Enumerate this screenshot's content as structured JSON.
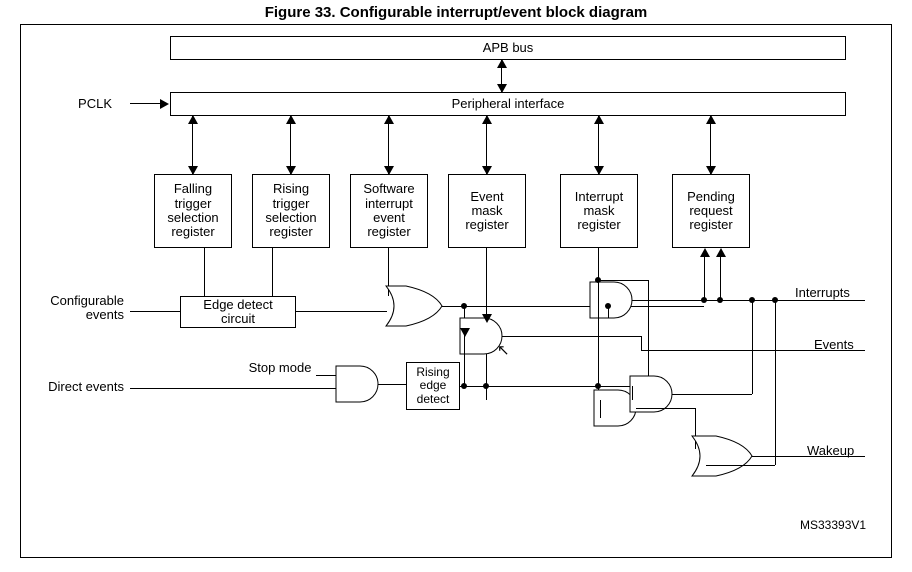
{
  "figure": {
    "caption": "Figure 33. Configurable interrupt/event block diagram",
    "ref": "MS33393V1"
  },
  "blocks": {
    "apb_bus": "APB bus",
    "periph_if": "Peripheral interface",
    "falling_reg_l1": "Falling",
    "falling_reg_l2": "trigger",
    "falling_reg_l3": "selection",
    "falling_reg_l4": "register",
    "rising_reg_l1": "Rising",
    "rising_reg_l2": "trigger",
    "rising_reg_l3": "selection",
    "rising_reg_l4": "register",
    "swi_reg_l1": "Software",
    "swi_reg_l2": "interrupt",
    "swi_reg_l3": "event",
    "swi_reg_l4": "register",
    "evmask_l1": "Event",
    "evmask_l2": "mask",
    "evmask_l3": "register",
    "intmask_l1": "Interrupt",
    "intmask_l2": "mask",
    "intmask_l3": "register",
    "pend_l1": "Pending",
    "pend_l2": "request",
    "pend_l3": "register",
    "edge_det": "Edge detect\ncircuit",
    "rising_edge_det": "Rising\nedge\ndetect"
  },
  "labels": {
    "pclk": "PCLK",
    "config_ev_l1": "Configurable",
    "config_ev_l2": "events",
    "direct_ev": "Direct events",
    "stop_mode": "Stop mode",
    "interrupts": "Interrupts",
    "events": "Events",
    "wakeup": "Wakeup"
  }
}
